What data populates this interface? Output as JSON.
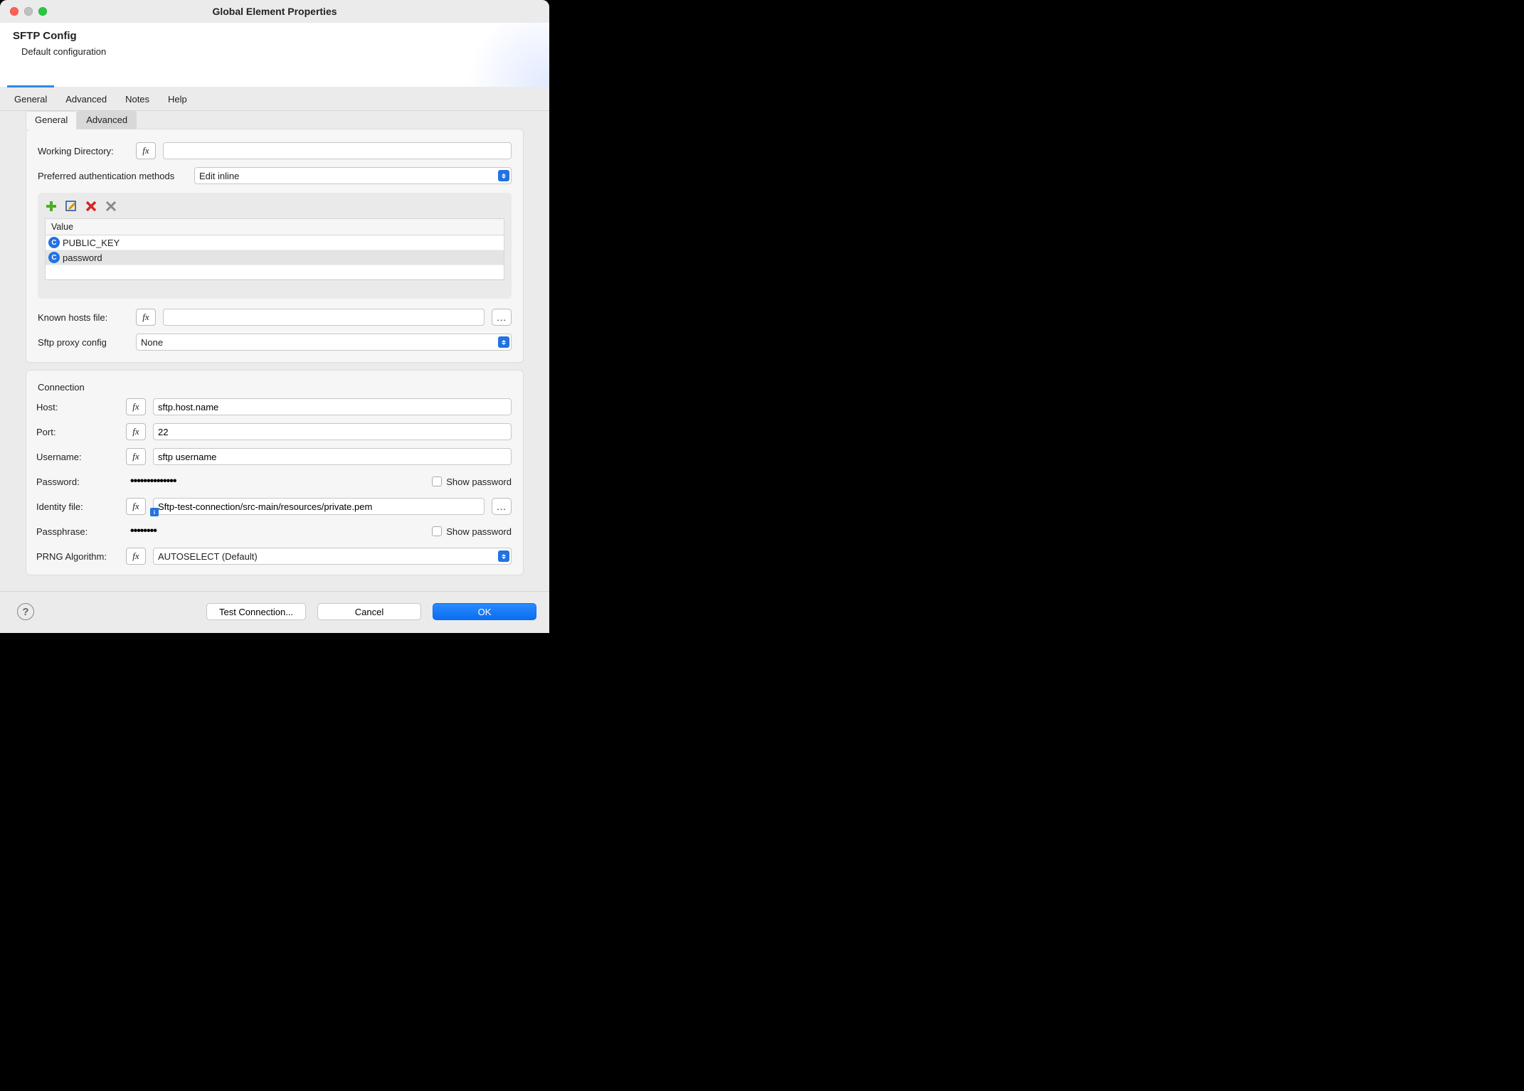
{
  "window": {
    "title": "Global Element Properties"
  },
  "header": {
    "title": "SFTP Config",
    "subtitle": "Default configuration"
  },
  "outerTabs": [
    "General",
    "Advanced",
    "Notes",
    "Help"
  ],
  "innerTabs": [
    "General",
    "Advanced"
  ],
  "general": {
    "workingDirLabel": "Working Directory:",
    "workingDir": "",
    "prefAuthLabel": "Preferred authentication methods",
    "prefAuthSelected": "Edit inline",
    "valueHeader": "Value",
    "authItems": [
      "PUBLIC_KEY",
      "password"
    ],
    "knownHostsLabel": "Known hosts file:",
    "knownHosts": "",
    "browse": "...",
    "sftpProxyLabel": "Sftp proxy config",
    "sftpProxySelected": "None"
  },
  "connection": {
    "sectionLabel": "Connection",
    "hostLabel": "Host:",
    "host": "sftp.host.name",
    "portLabel": "Port:",
    "port": "22",
    "usernameLabel": "Username:",
    "username": "sftp username",
    "passwordLabel": "Password:",
    "password": "••••••••••••••",
    "showPassword": "Show password",
    "identityLabel": "Identity file:",
    "identity": "Sftp-test-connection/src-main/resources/private.pem",
    "passphraseLabel": "Passphrase:",
    "passphrase": "••••••••",
    "prngLabel": "PRNG Algorithm:",
    "prngSelected": "AUTOSELECT (Default)"
  },
  "footer": {
    "test": "Test Connection...",
    "cancel": "Cancel",
    "ok": "OK",
    "help": "?"
  }
}
